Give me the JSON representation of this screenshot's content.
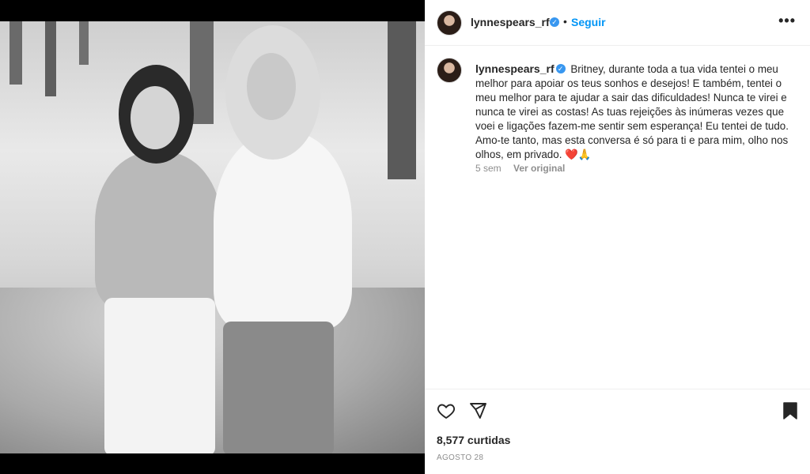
{
  "post": {
    "username": "lynnespears_rf",
    "follow_label": "Seguir",
    "more_label": "•••",
    "caption_text": "Britney, durante toda a tua vida tentei o meu melhor para apoiar os teus sonhos e desejos! E também, tentei o meu melhor para te ajudar a sair das dificuldades! Nunca te virei e nunca te virei as costas! As tuas rejeições às inúmeras vezes que voei e ligações fazem-me sentir sem esperança! Eu tentei de tudo. Amo-te tanto, mas esta conversa é só para ti e para mim, olho nos olhos, em privado.",
    "caption_emojis": "❤️🙏",
    "time_ago": "5 sem",
    "see_original_label": "Ver original",
    "likes": "8,577 curtidas",
    "date": "AGOSTO 28"
  },
  "icons": {
    "verified": "verified-badge-icon",
    "like": "heart-icon",
    "share": "paper-plane-icon",
    "save": "bookmark-icon",
    "more": "more-options-icon"
  },
  "colors": {
    "accent": "#0095f6",
    "verified": "#3897f0",
    "muted": "#8e8e8e"
  }
}
